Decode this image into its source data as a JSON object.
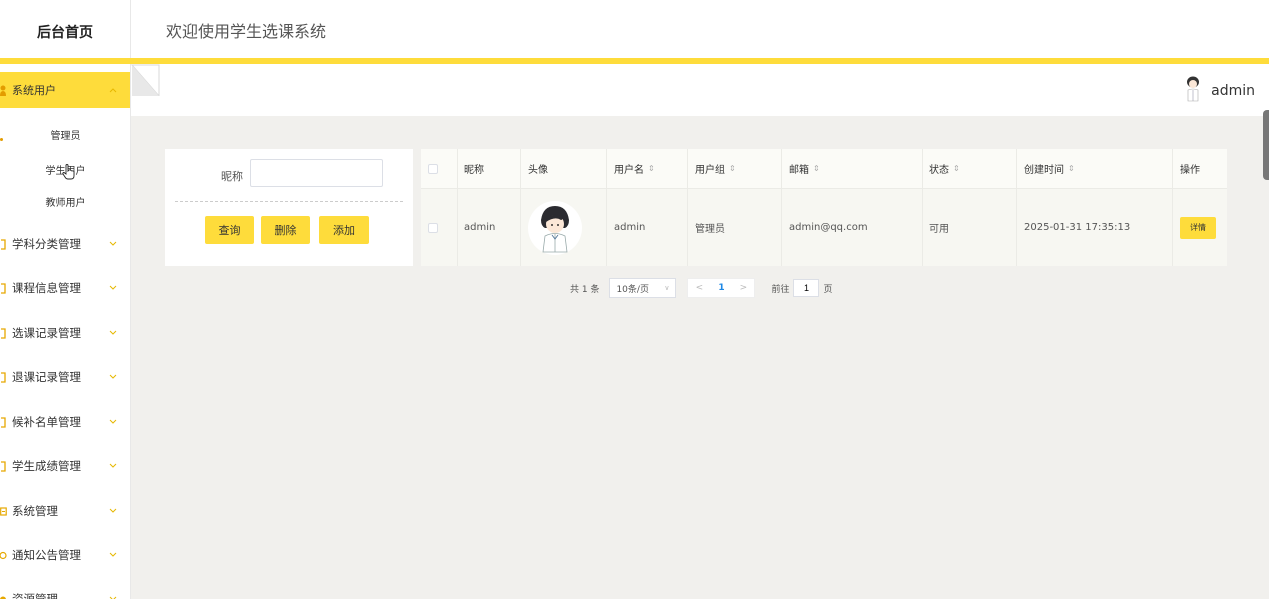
{
  "brand": "后台首页",
  "header": {
    "welcome": "欢迎使用学生选课系统"
  },
  "user": {
    "name": "admin"
  },
  "sidebar": {
    "active": {
      "label": "系统用户"
    },
    "subitems": [
      "管理员",
      "学生用户",
      "教师用户"
    ],
    "items": [
      {
        "label": "学科分类管理"
      },
      {
        "label": "课程信息管理"
      },
      {
        "label": "选课记录管理"
      },
      {
        "label": "退课记录管理"
      },
      {
        "label": "候补名单管理"
      },
      {
        "label": "学生成绩管理"
      },
      {
        "label": "系统管理"
      },
      {
        "label": "通知公告管理"
      },
      {
        "label": "资源管理"
      }
    ]
  },
  "search": {
    "label": "昵称",
    "value": "",
    "buttons": {
      "query": "查询",
      "delete": "删除",
      "add": "添加"
    }
  },
  "table": {
    "headers": {
      "nickname": "昵称",
      "avatar": "头像",
      "username": "用户名",
      "group": "用户组",
      "email": "邮箱",
      "status": "状态",
      "created": "创建时间",
      "actions": "操作"
    },
    "sort_icon": "⇕",
    "rows": [
      {
        "nickname": "admin",
        "username": "admin",
        "group": "管理员",
        "email": "admin@qq.com",
        "status": "可用",
        "created": "2025-01-31 17:35:13",
        "action": "详情"
      }
    ]
  },
  "pagination": {
    "total_text": "共 1 条",
    "page_size": "10条/页",
    "prev": "<",
    "current": "1",
    "next": ">",
    "goto_label": "前往",
    "goto_value": "1",
    "page_suffix": "页"
  },
  "colors": {
    "accent": "#fedc3b",
    "link": "#1e88e5"
  },
  "icons": {
    "sidebar_active": "user-icon",
    "sidebar_item": "menu-icon",
    "chevron": "chevron-down-icon"
  }
}
